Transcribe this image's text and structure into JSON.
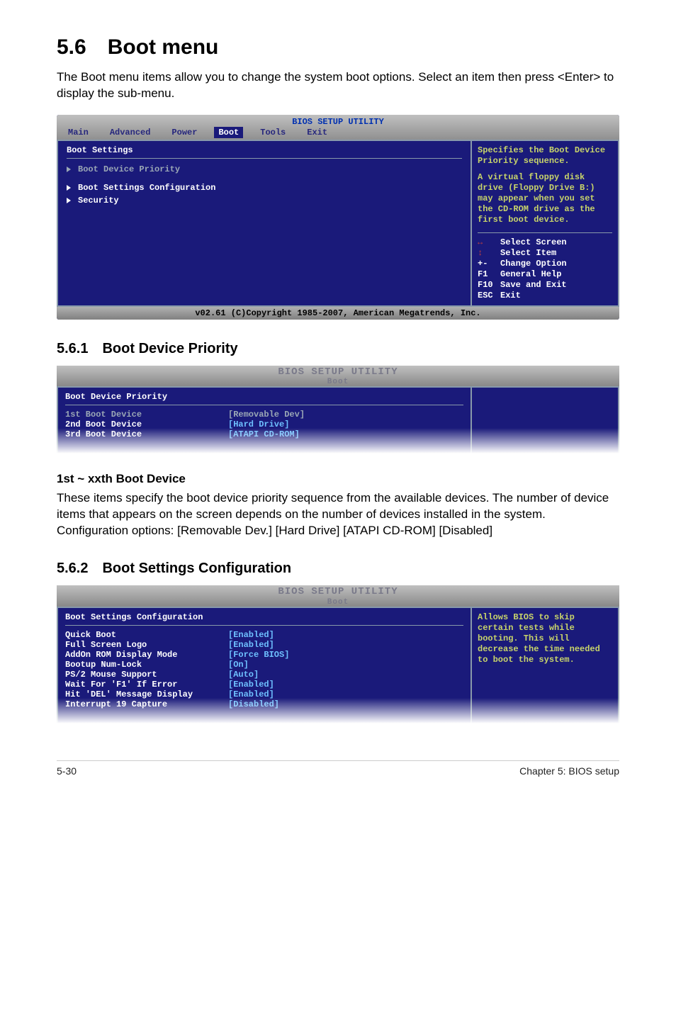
{
  "heading": "5.6 Boot menu",
  "intro": "The Boot menu items allow you to change the system boot options. Select an item then press <Enter> to display the sub-menu.",
  "bios1": {
    "top_title": "BIOS SETUP UTILITY",
    "tabs": [
      "Main",
      "Advanced",
      "Power",
      "Boot",
      "Tools",
      "Exit"
    ],
    "panel_title": "Boot Settings",
    "menu_selected": "Boot Device Priority",
    "menu_item2": "Boot Settings Configuration",
    "menu_item3": "Security",
    "help_block": "Specifies the Boot Device Priority sequence.",
    "help_block2": "A virtual floppy disk drive (Floppy Drive B:) may appear when you set the CD-ROM drive as the first boot device.",
    "hints": {
      "select_screen": "Select Screen",
      "select_item": "Select Item",
      "change_option": "Change Option",
      "general_help": "General Help",
      "save_exit": "Save and Exit",
      "exit": "Exit"
    },
    "footer": "v02.61 (C)Copyright 1985-2007, American Megatrends, Inc."
  },
  "sub1_title": "5.6.1 Boot Device Priority",
  "bios2": {
    "header_big": "BIOS SETUP UTILITY",
    "header_small": "Boot",
    "panel_title": "Boot Device Priority",
    "rows": [
      {
        "label": "1st Boot Device",
        "value": "[Removable Dev]",
        "sel": true
      },
      {
        "label": "2nd Boot Device",
        "value": "[Hard Drive]",
        "sel": false
      },
      {
        "label": "3rd Boot Device",
        "value": "[ATAPI CD-ROM]",
        "sel": false
      }
    ]
  },
  "para1_title": "1st ~ xxth Boot Device",
  "para1_body": "These items specify the boot device priority sequence from the available devices. The number of device items that appears on the screen depends on the number of devices installed in the system. Configuration options: [Removable Dev.] [Hard Drive] [ATAPI CD-ROM] [Disabled]",
  "sub2_title": "5.6.2 Boot Settings Configuration",
  "bios3": {
    "header_big": "BIOS SETUP UTILITY",
    "header_small": "Boot",
    "panel_title": "Boot Settings Configuration",
    "rows": [
      {
        "label": "Quick Boot",
        "value": "[Enabled]"
      },
      {
        "label": "Full Screen Logo",
        "value": "[Enabled]"
      },
      {
        "label": "AddOn ROM Display Mode",
        "value": "[Force BIOS]"
      },
      {
        "label": "Bootup Num-Lock",
        "value": "[On]"
      },
      {
        "label": "PS/2 Mouse Support",
        "value": "[Auto]"
      },
      {
        "label": "Wait For 'F1' If Error",
        "value": "[Enabled]"
      },
      {
        "label": "Hit 'DEL' Message Display",
        "value": "[Enabled]"
      },
      {
        "label": "Interrupt 19 Capture",
        "value": "[Disabled]"
      }
    ],
    "help": "Allows BIOS to skip certain tests while booting. This will decrease the time needed to boot the system."
  },
  "footer_left": "5-30",
  "footer_right": "Chapter 5: BIOS setup"
}
